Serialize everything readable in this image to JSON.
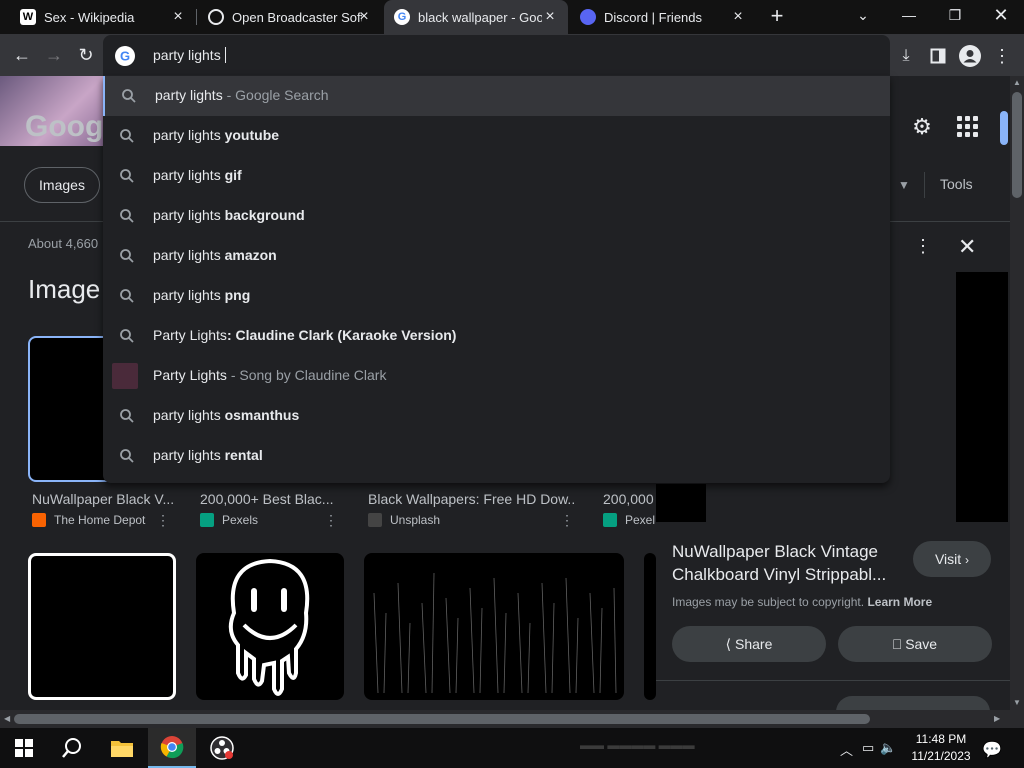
{
  "browser": {
    "tabs": [
      {
        "title": "Sex - Wikipedia",
        "favicon": "W"
      },
      {
        "title": "Open Broadcaster Softw",
        "favicon": "obs"
      },
      {
        "title": "black wallpaper - Goog",
        "favicon": "G"
      },
      {
        "title": "Discord | Friends",
        "favicon": "discord"
      }
    ],
    "omnibox_value": "party lights"
  },
  "suggestions": [
    {
      "prefix": "party lights",
      "bold": "",
      "hint": "- Google Search",
      "kind": "search"
    },
    {
      "prefix": "party lights ",
      "bold": "youtube",
      "hint": "",
      "kind": "search"
    },
    {
      "prefix": "party lights ",
      "bold": "gif",
      "hint": "",
      "kind": "search"
    },
    {
      "prefix": "party lights ",
      "bold": "background",
      "hint": "",
      "kind": "search"
    },
    {
      "prefix": "party lights ",
      "bold": "amazon",
      "hint": "",
      "kind": "search"
    },
    {
      "prefix": "party lights ",
      "bold": "png",
      "hint": "",
      "kind": "search"
    },
    {
      "prefix": "Party Lights",
      "bold": ": Claudine Clark (Karaoke Version)",
      "hint": "",
      "kind": "search"
    },
    {
      "prefix": "Party Lights",
      "bold": "",
      "hint": "- Song by Claudine Clark",
      "kind": "entity"
    },
    {
      "prefix": "party lights ",
      "bold": "osmanthus",
      "hint": "",
      "kind": "search"
    },
    {
      "prefix": "party lights ",
      "bold": "rental",
      "hint": "",
      "kind": "search"
    }
  ],
  "page": {
    "logo_text": "Googl",
    "images_chip": "Images",
    "tools_label": "Tools",
    "result_count": "About 4,660",
    "section_heading": "Image",
    "results": [
      {
        "title": "NuWallpaper Black V...",
        "source": "The Home Depot",
        "source_color": "#f96302"
      },
      {
        "title": "200,000+ Best Blac...",
        "source": "Pexels",
        "source_color": "#05a081"
      },
      {
        "title": "Black Wallpapers: Free HD Dow...",
        "source": "Unsplash",
        "source_color": "#444444"
      },
      {
        "title": "200,000",
        "source": "Pexel",
        "source_color": "#05a081"
      }
    ]
  },
  "panel": {
    "title": "NuWallpaper Black Vintage Chalkboard Vinyl Strippabl...",
    "visit_label": "Visit",
    "copyright_text": "Images may be subject to copyright.",
    "learn_more": "Learn More",
    "share_label": "Share",
    "save_label": "Save"
  },
  "taskbar": {
    "time": "11:48 PM",
    "date": "11/21/2023"
  }
}
